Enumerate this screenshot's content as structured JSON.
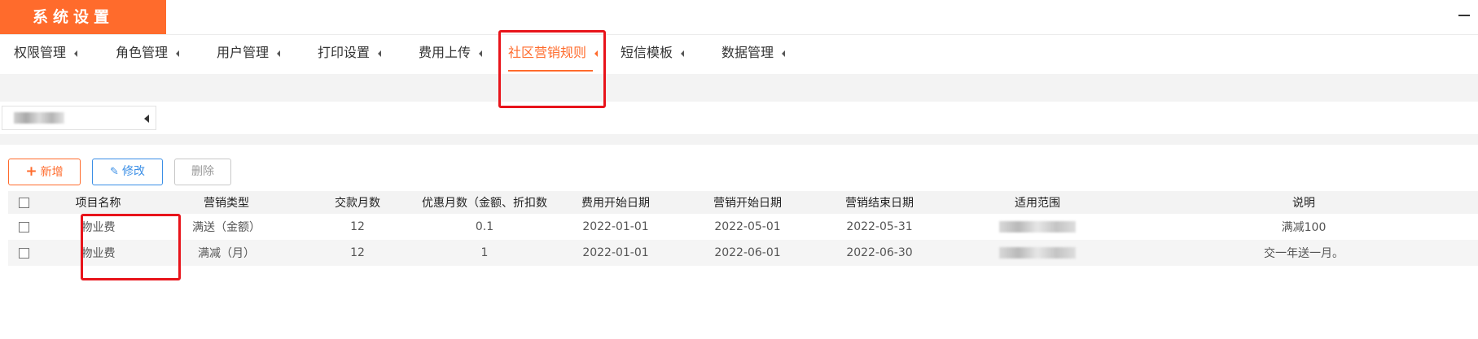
{
  "window": {
    "title": "系统设置"
  },
  "nav": {
    "items": [
      {
        "label": "权限管理"
      },
      {
        "label": "角色管理"
      },
      {
        "label": "用户管理"
      },
      {
        "label": "打印设置"
      },
      {
        "label": "费用上传"
      },
      {
        "label": "社区营销规则",
        "active": true
      },
      {
        "label": "短信模板"
      },
      {
        "label": "数据管理"
      }
    ]
  },
  "toolbar": {
    "add_label": "新增",
    "edit_label": "修改",
    "delete_label": "删除"
  },
  "table": {
    "headers": [
      "项目名称",
      "营销类型",
      "交款月数",
      "优惠月数（金额、折扣数",
      "费用开始日期",
      "营销开始日期",
      "营销结束日期",
      "适用范围",
      "说明"
    ],
    "rows": [
      {
        "item": "物业费",
        "type": "满送（金额）",
        "months": "12",
        "discount": "0.1",
        "fee_start": "2022-01-01",
        "promo_start": "2022-05-01",
        "promo_end": "2022-05-31",
        "note": "满减100"
      },
      {
        "item": "物业费",
        "type": "满减（月）",
        "months": "12",
        "discount": "1",
        "fee_start": "2022-01-01",
        "promo_start": "2022-06-01",
        "promo_end": "2022-06-30",
        "note": "交一年送一月。"
      }
    ]
  },
  "colors": {
    "accent": "#ff6b2c",
    "edit_blue": "#3a8ee6",
    "highlight_red": "#e8141b"
  }
}
